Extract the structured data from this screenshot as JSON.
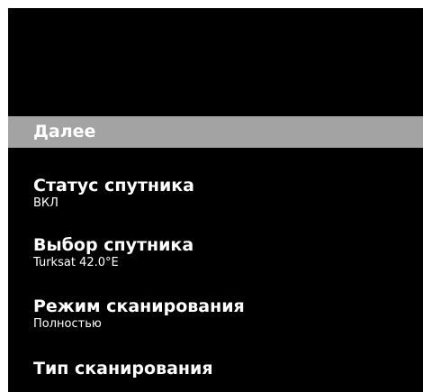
{
  "menu": {
    "highlighted": {
      "label": "Далее"
    },
    "items": [
      {
        "title": "Статус спутника",
        "value": "ВКЛ"
      },
      {
        "title": "Выбор спутника",
        "value": "Turksat 42.0°E"
      },
      {
        "title": "Режим сканирования",
        "value": "Полностью"
      },
      {
        "title": "Тип сканирования",
        "value": ""
      }
    ]
  },
  "colors": {
    "background": "#000000",
    "highlight": "#a3a3a3",
    "text": "#ffffff"
  }
}
